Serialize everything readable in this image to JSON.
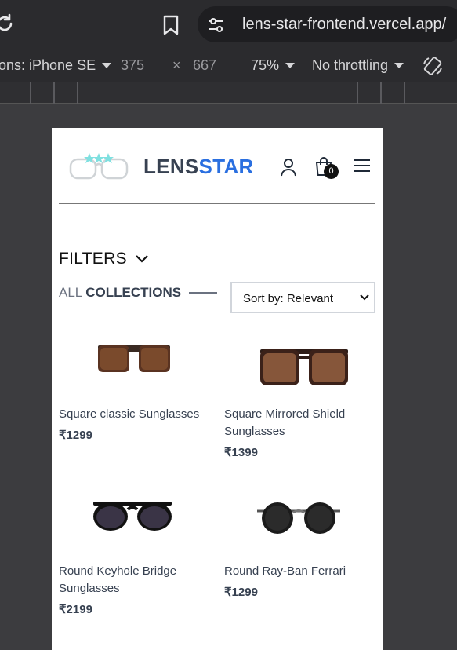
{
  "browser": {
    "url": "lens-star-frontend.vercel.app/"
  },
  "devtools": {
    "device": "ons: iPhone SE",
    "width": "375",
    "times": "×",
    "height": "667",
    "zoom": "75%",
    "throttling": "No throttling"
  },
  "header": {
    "brand_part1": "LENS",
    "brand_part2": "STAR",
    "cart_count": "0"
  },
  "filters": {
    "label": "FILTERS"
  },
  "collections": {
    "part1": "ALL",
    "part2": "COLLECTIONS"
  },
  "sort": {
    "selected": "Sort by: Relevant"
  },
  "products": [
    {
      "name": "Square classic Sunglasses",
      "price": "₹1299"
    },
    {
      "name": "Square Mirrored Shield Sunglasses",
      "price": "₹1399"
    },
    {
      "name": "Round Keyhole Bridge Sunglasses",
      "price": "₹2199"
    },
    {
      "name": "Round Ray-Ban Ferrari",
      "price": "₹1299"
    }
  ],
  "colors": {
    "brand_dark": "#374151",
    "brand_blue": "#2a6fe0",
    "browser_bg": "#2b2b2e"
  }
}
